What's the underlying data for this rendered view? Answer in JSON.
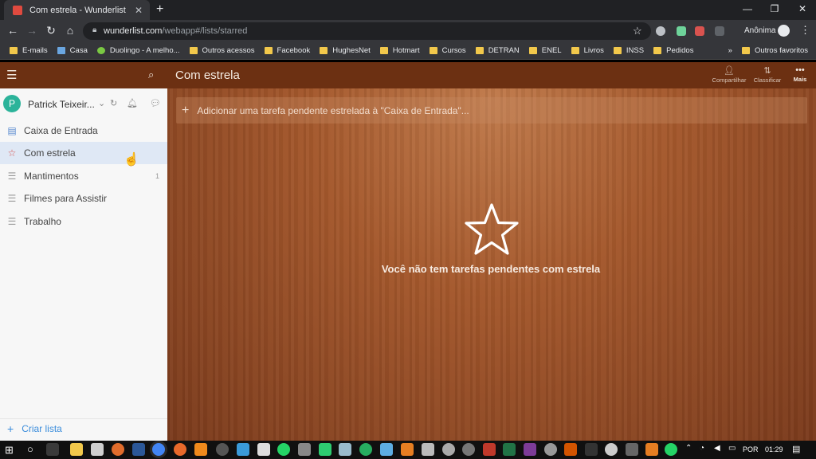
{
  "browser": {
    "tab_title": "Com estrela - Wunderlist",
    "url_host": "wunderlist.com",
    "url_path": "/webapp#/lists/starred",
    "profile_label": "Anônima",
    "bookmarks": [
      "E-mails",
      "Casa",
      "Duolingo - A melho...",
      "Outros acessos",
      "Facebook",
      "HughesNet",
      "Hotmart",
      "Cursos",
      "DETRAN",
      "ENEL",
      "Livros",
      "INSS",
      "Pedidos"
    ],
    "other_bookmarks": "Outros favoritos",
    "overflow": "»"
  },
  "sidebar": {
    "user_initial": "P",
    "user_name": "Patrick Teixeir...",
    "lists": [
      {
        "label": "Caixa de Entrada",
        "icon": "inbox-icon",
        "count": ""
      },
      {
        "label": "Com estrela",
        "icon": "star-icon",
        "count": ""
      },
      {
        "label": "Mantimentos",
        "icon": "list-icon",
        "count": "1"
      },
      {
        "label": "Filmes para Assistir",
        "icon": "list-icon",
        "count": ""
      },
      {
        "label": "Trabalho",
        "icon": "list-icon",
        "count": ""
      }
    ],
    "create_list": "Criar lista"
  },
  "main": {
    "title": "Com estrela",
    "share_label": "Compartilhar",
    "sort_label": "Classificar",
    "more_label": "Mais",
    "add_task_placeholder": "Adicionar uma tarefa pendente estrelada à \"Caixa de Entrada\"...",
    "empty_message": "Você não tem tarefas pendentes com estrela"
  },
  "taskbar": {
    "language": "POR",
    "time": "01:29"
  },
  "colors": {
    "header_brown": "#6c3012",
    "accent_blue": "#3d8edc",
    "avatar_green": "#2bb39a"
  }
}
